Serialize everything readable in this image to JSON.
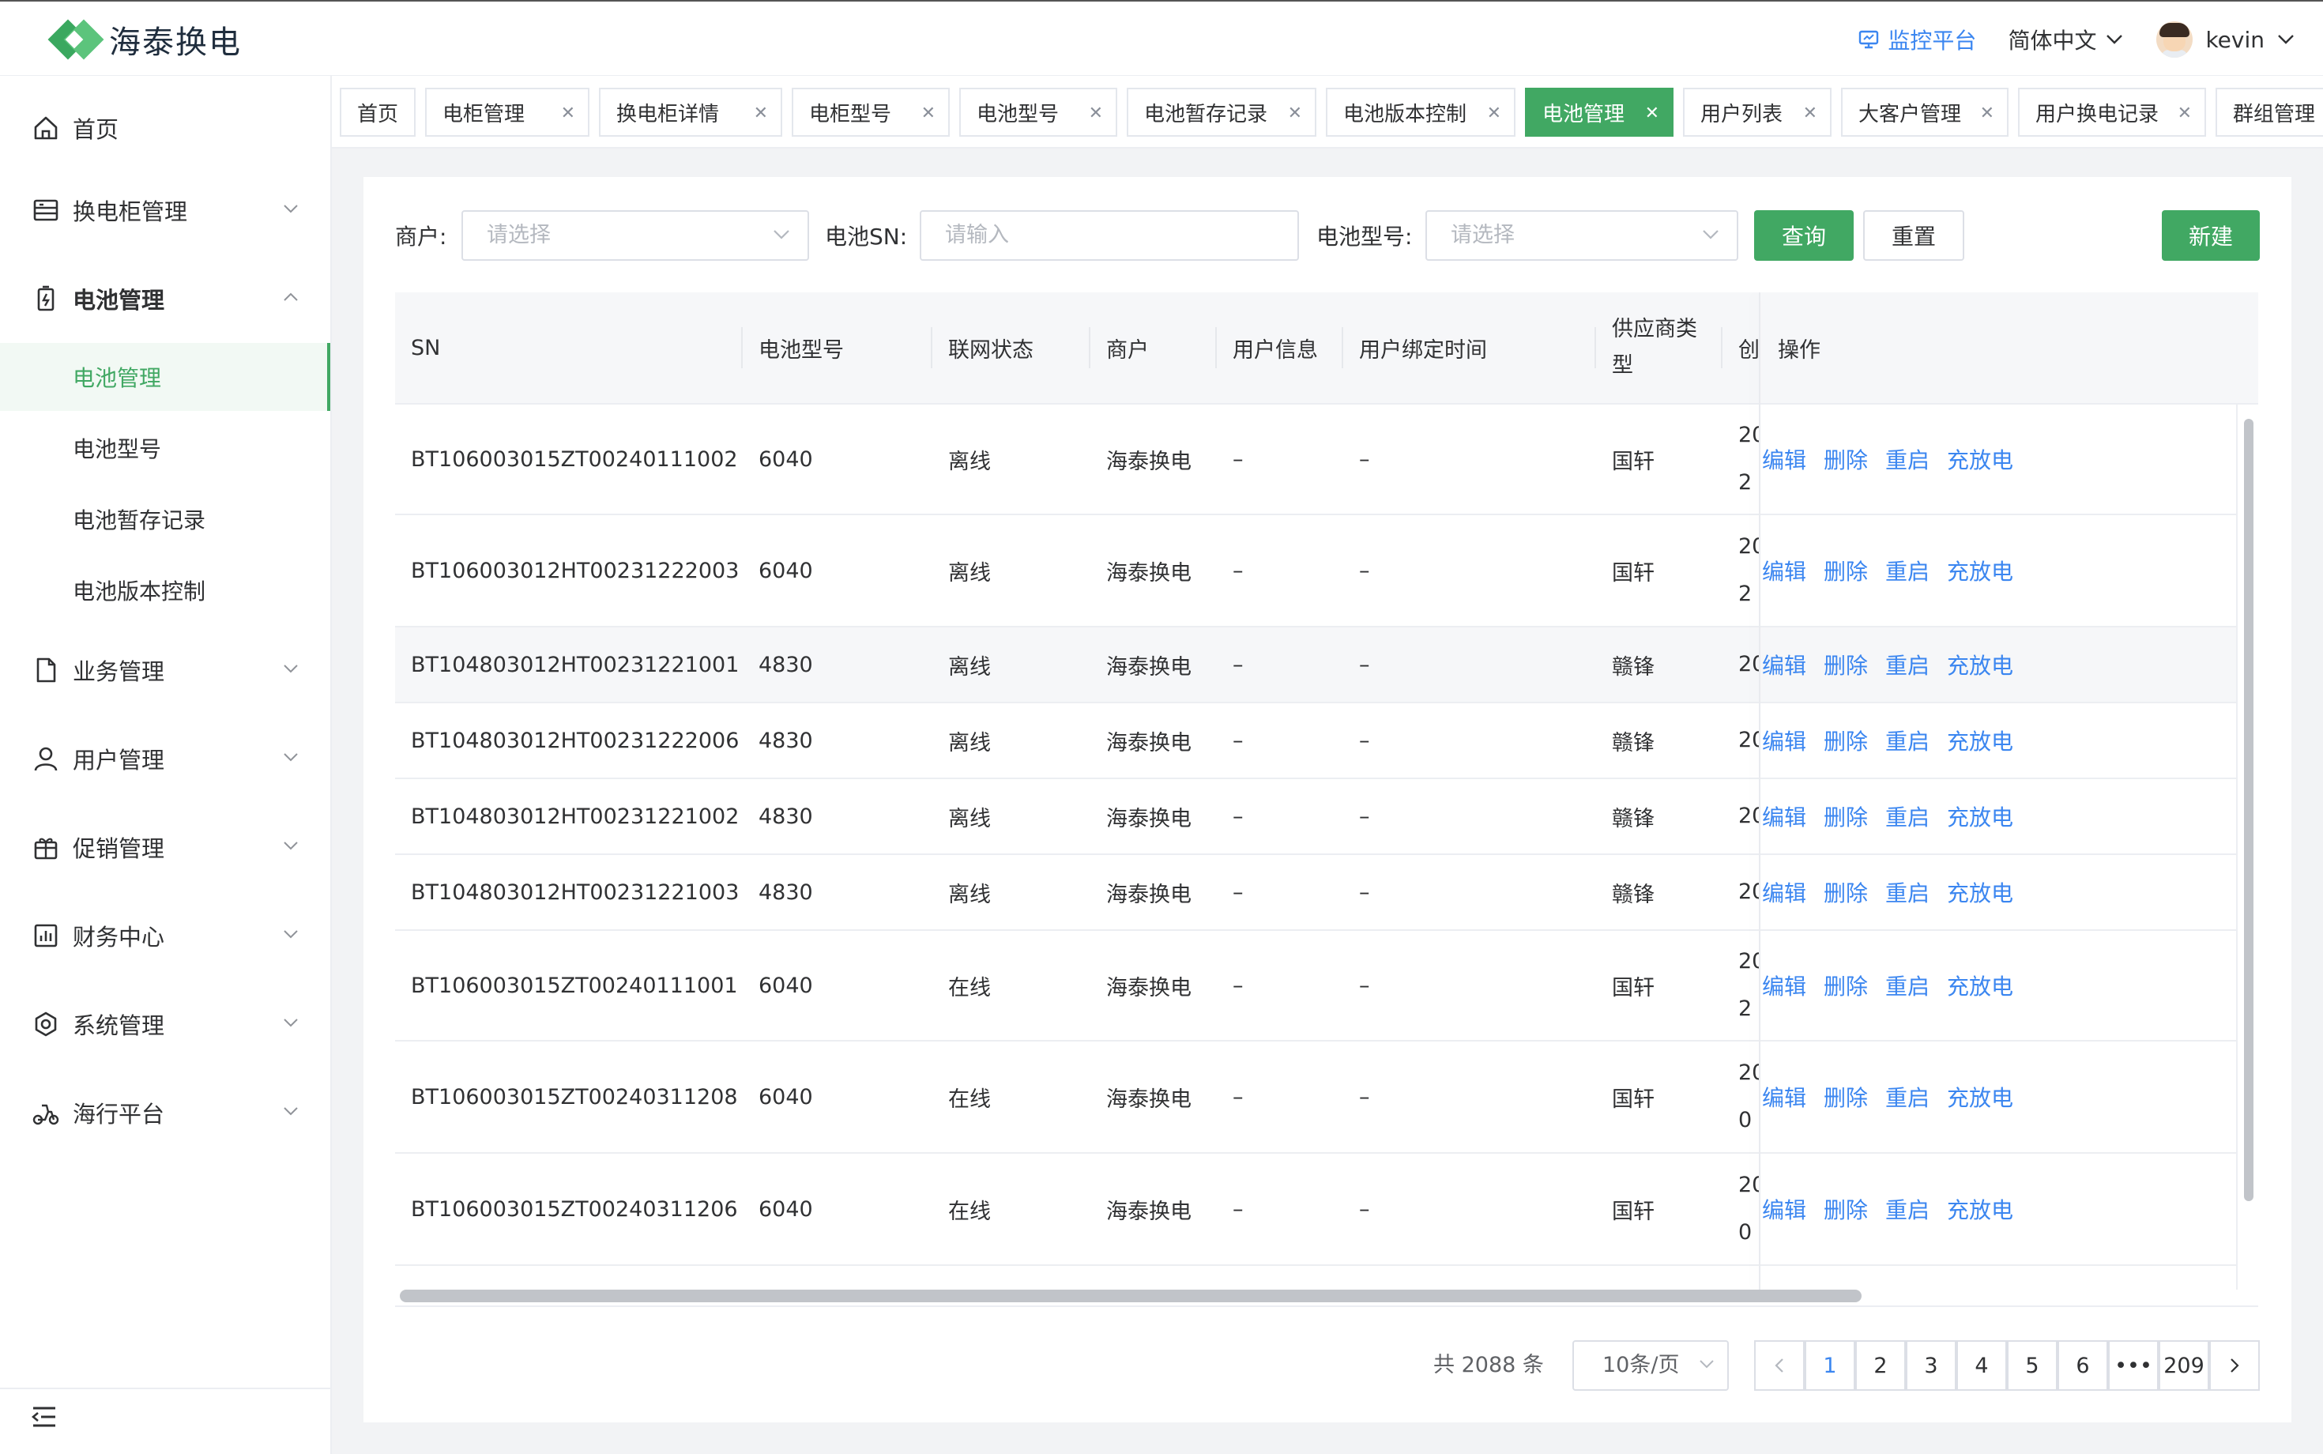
{
  "app": {
    "logo_text": "海泰换电",
    "brand_color": "#41a863",
    "link_color": "#3b86f0"
  },
  "header": {
    "monitor_label": "监控平台",
    "language": "简体中文",
    "username": "kevin"
  },
  "sidebar": {
    "items": [
      {
        "label": "首页",
        "icon": "home-icon"
      },
      {
        "label": "换电柜管理",
        "icon": "cabinet-icon"
      },
      {
        "label": "电池管理",
        "icon": "battery-icon",
        "expanded": true
      },
      {
        "label": "业务管理",
        "icon": "document-icon"
      },
      {
        "label": "用户管理",
        "icon": "user-icon"
      },
      {
        "label": "促销管理",
        "icon": "gift-icon"
      },
      {
        "label": "财务中心",
        "icon": "chart-icon"
      },
      {
        "label": "系统管理",
        "icon": "settings-icon"
      },
      {
        "label": "海行平台",
        "icon": "scooter-icon"
      }
    ],
    "sub_items": [
      "电池管理",
      "电池型号",
      "电池暂存记录",
      "电池版本控制"
    ]
  },
  "tabs": [
    "首页",
    "电柜管理",
    "换电柜详情",
    "电柜型号",
    "电池型号",
    "电池暂存记录",
    "电池版本控制",
    "电池管理",
    "用户列表",
    "大客户管理",
    "用户换电记录",
    "群组管理"
  ],
  "filters": {
    "merchant_label": "商户:",
    "merchant_placeholder": "请选择",
    "sn_label": "电池SN:",
    "sn_placeholder": "请输入",
    "model_label": "电池型号:",
    "model_placeholder": "请选择",
    "query": "查询",
    "reset": "重置",
    "create": "新建"
  },
  "table": {
    "columns": {
      "sn": "SN",
      "model": "电池型号",
      "status": "联网状态",
      "merchant": "商户",
      "user_info": "用户信息",
      "bind_time": "用户绑定时间",
      "supplier_type_1": "供应商类",
      "supplier_type_2": "型",
      "created": "创",
      "actions": "操作"
    },
    "actions": [
      "编辑",
      "删除",
      "重启",
      "充放电"
    ],
    "rows": [
      {
        "sn": "BT106003015ZT00240111002",
        "model": "6040",
        "status": "离线",
        "merchant": "海泰换电",
        "user_info": "–",
        "bind_time": "–",
        "supplier": "国轩",
        "created_1": "20",
        "created_2": "2"
      },
      {
        "sn": "BT106003012HT00231222003",
        "model": "6040",
        "status": "离线",
        "merchant": "海泰换电",
        "user_info": "–",
        "bind_time": "–",
        "supplier": "国轩",
        "created_1": "20",
        "created_2": "2"
      },
      {
        "sn": "BT104803012HT00231221001",
        "model": "4830",
        "status": "离线",
        "merchant": "海泰换电",
        "user_info": "–",
        "bind_time": "–",
        "supplier": "赣锋",
        "created_1": "20",
        "created_2": ""
      },
      {
        "sn": "BT104803012HT00231222006",
        "model": "4830",
        "status": "离线",
        "merchant": "海泰换电",
        "user_info": "–",
        "bind_time": "–",
        "supplier": "赣锋",
        "created_1": "20",
        "created_2": ""
      },
      {
        "sn": "BT104803012HT00231221002",
        "model": "4830",
        "status": "离线",
        "merchant": "海泰换电",
        "user_info": "–",
        "bind_time": "–",
        "supplier": "赣锋",
        "created_1": "20",
        "created_2": ""
      },
      {
        "sn": "BT104803012HT00231221003",
        "model": "4830",
        "status": "离线",
        "merchant": "海泰换电",
        "user_info": "–",
        "bind_time": "–",
        "supplier": "赣锋",
        "created_1": "20",
        "created_2": ""
      },
      {
        "sn": "BT106003015ZT00240111001",
        "model": "6040",
        "status": "在线",
        "merchant": "海泰换电",
        "user_info": "–",
        "bind_time": "–",
        "supplier": "国轩",
        "created_1": "20",
        "created_2": "2"
      },
      {
        "sn": "BT106003015ZT00240311208",
        "model": "6040",
        "status": "在线",
        "merchant": "海泰换电",
        "user_info": "–",
        "bind_time": "–",
        "supplier": "国轩",
        "created_1": "20",
        "created_2": "0"
      },
      {
        "sn": "BT106003015ZT00240311206",
        "model": "6040",
        "status": "在线",
        "merchant": "海泰换电",
        "user_info": "–",
        "bind_time": "–",
        "supplier": "国轩",
        "created_1": "20",
        "created_2": "0"
      }
    ]
  },
  "pagination": {
    "total": "共 2088 条",
    "page_size": "10条/页",
    "pages": [
      "1",
      "2",
      "3",
      "4",
      "5",
      "6",
      "•••",
      "209"
    ],
    "current": "1"
  }
}
